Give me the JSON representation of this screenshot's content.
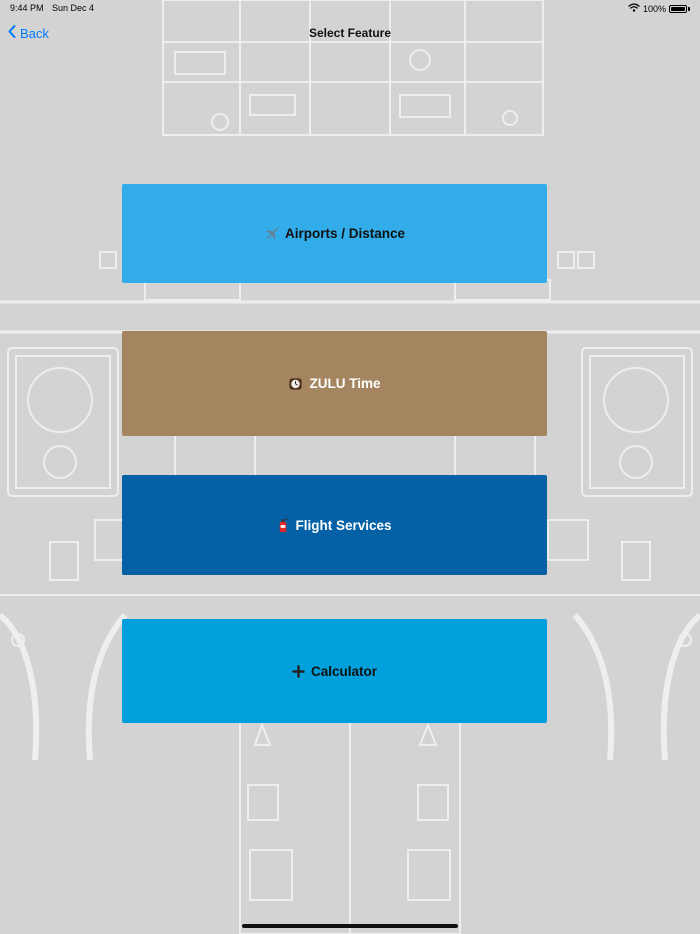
{
  "status_bar": {
    "time": "9:44 PM",
    "date": "Sun Dec 4",
    "battery_text": "100%",
    "battery_level": 1.0,
    "wifi_icon": "wifi-icon",
    "battery_icon": "battery-icon"
  },
  "nav": {
    "back_label": "Back",
    "title": "Select Feature"
  },
  "features": [
    {
      "label": "Airports / Distance",
      "icon": "airplane-icon",
      "color": "#32adea"
    },
    {
      "label": "ZULU Time",
      "icon": "clock-icon",
      "color": "#a5855f"
    },
    {
      "label": "Flight Services",
      "icon": "fire-extinguisher-icon",
      "color": "#0461a6"
    },
    {
      "label": "Calculator",
      "icon": "plus-icon",
      "color": "#00a0dc"
    }
  ],
  "colors": {
    "background": "#d3d3d3",
    "accent": "#007aff"
  }
}
